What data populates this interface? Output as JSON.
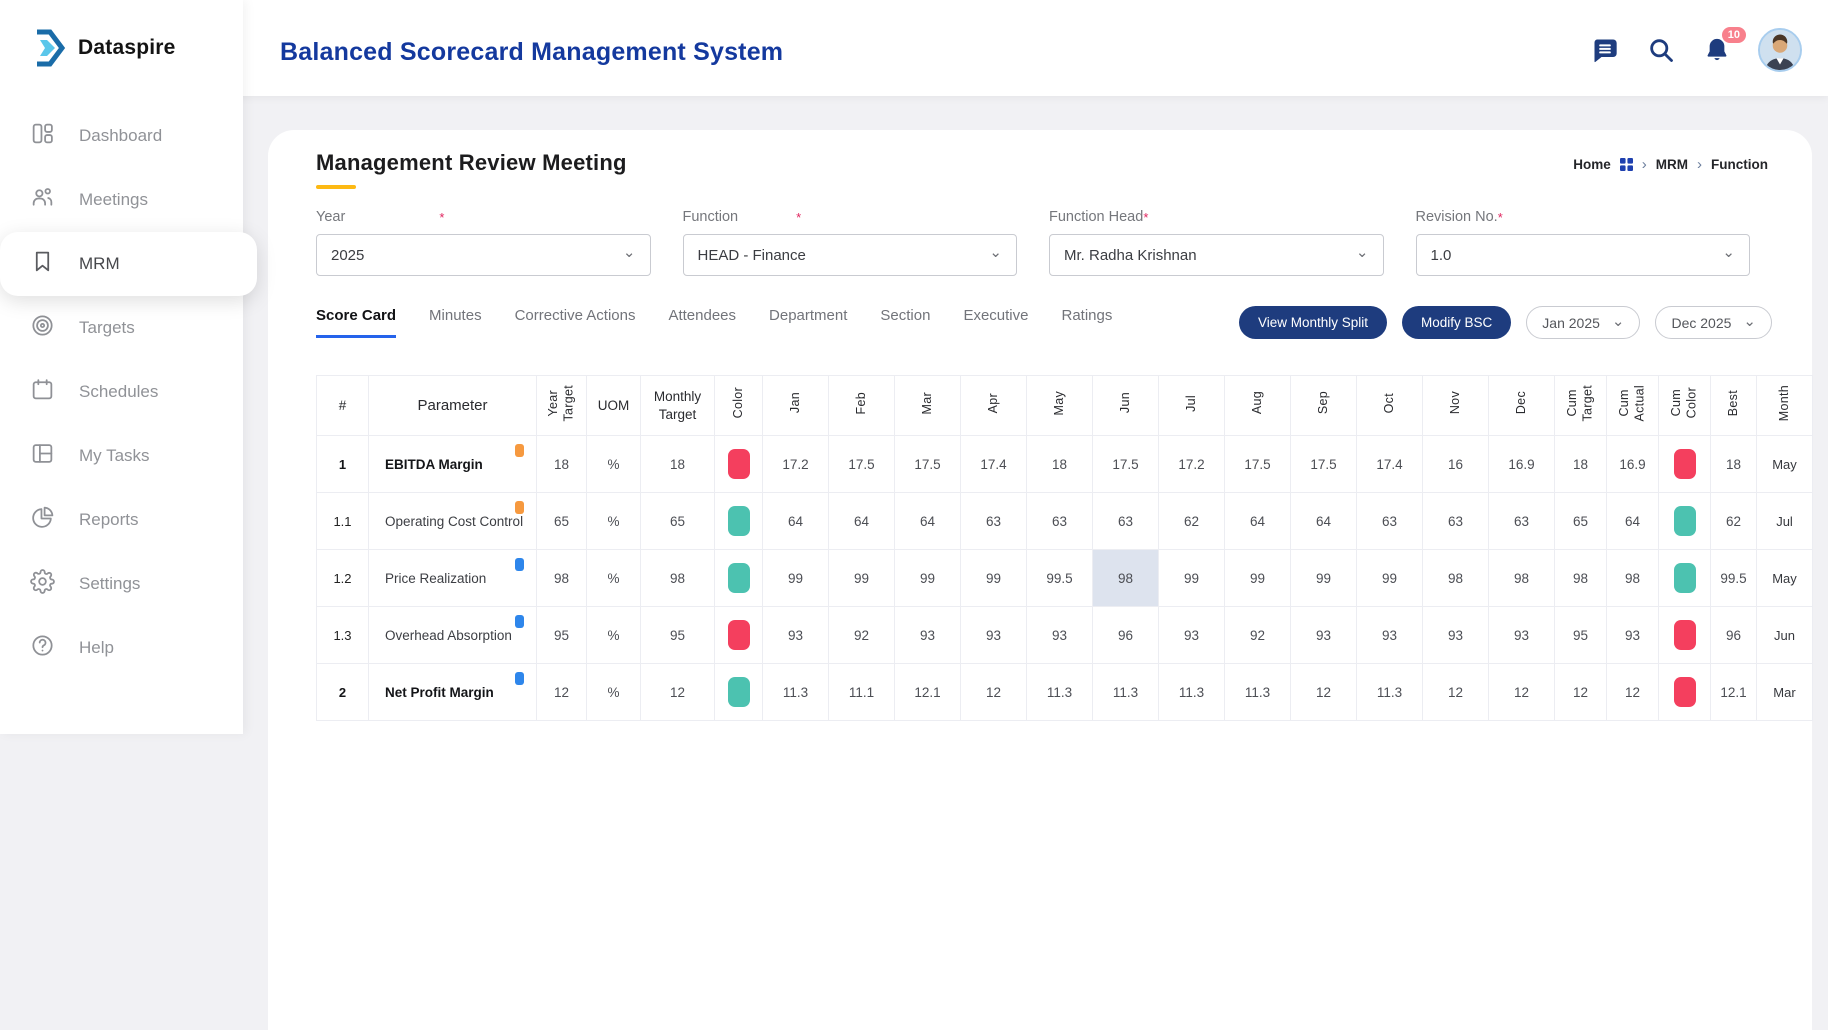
{
  "brand": {
    "name": "Dataspire",
    "logo_icon": "dataspire-chevron-logo"
  },
  "header": {
    "title": "Balanced Scorecard Management System",
    "notification_count": "10",
    "icons": [
      "chat-icon",
      "search-icon",
      "bell-icon",
      "avatar"
    ]
  },
  "sidebar": {
    "items": [
      {
        "id": "dashboard",
        "label": "Dashboard",
        "icon": "dashboard-icon",
        "active": false
      },
      {
        "id": "meetings",
        "label": "Meetings",
        "icon": "meetings-icon",
        "active": false
      },
      {
        "id": "mrm",
        "label": "MRM",
        "icon": "bookmark-icon",
        "active": true
      },
      {
        "id": "targets",
        "label": "Targets",
        "icon": "target-icon",
        "active": false
      },
      {
        "id": "schedules",
        "label": "Schedules",
        "icon": "calendar-icon",
        "active": false
      },
      {
        "id": "mytasks",
        "label": "My Tasks",
        "icon": "tasks-icon",
        "active": false
      },
      {
        "id": "reports",
        "label": "Reports",
        "icon": "pie-chart-icon",
        "active": false
      },
      {
        "id": "settings",
        "label": "Settings",
        "icon": "gear-icon",
        "active": false
      },
      {
        "id": "help",
        "label": "Help",
        "icon": "help-icon",
        "active": false
      }
    ]
  },
  "page": {
    "title": "Management Review Meeting",
    "breadcrumb": [
      "Home",
      "MRM",
      "Function"
    ],
    "filters": [
      {
        "id": "year",
        "label": "Year",
        "required": "*",
        "value": "2025"
      },
      {
        "id": "function",
        "label": "Function",
        "required": "*",
        "value": "HEAD - Finance"
      },
      {
        "id": "function-head",
        "label": "Function Head",
        "required": "*",
        "value": "Mr. Radha Krishnan"
      },
      {
        "id": "revision-no",
        "label": "Revision No.",
        "required": "*",
        "value": "1.0"
      }
    ],
    "tabs": [
      "Score Card",
      "Minutes",
      "Corrective Actions",
      "Attendees",
      "Department",
      "Section",
      "Executive",
      "Ratings"
    ],
    "active_tab": 0,
    "actions": {
      "view_monthly_split": "View Monthly Split",
      "modify_bsc": "Modify BSC",
      "range_from": "Jan 2025",
      "range_to": "Dec 2025"
    },
    "table": {
      "columns": [
        {
          "label": "#"
        },
        {
          "label": "Parameter",
          "big": true
        },
        {
          "label": "Year\nTarget",
          "rot": true
        },
        {
          "label": "UOM"
        },
        {
          "label": "Monthly Target"
        },
        {
          "label": "Color",
          "rot": true
        },
        {
          "label": "Jan",
          "rot": true
        },
        {
          "label": "Feb",
          "rot": true
        },
        {
          "label": "Mar",
          "rot": true
        },
        {
          "label": "Apr",
          "rot": true
        },
        {
          "label": "May",
          "rot": true
        },
        {
          "label": "Jun",
          "rot": true
        },
        {
          "label": "Jul",
          "rot": true
        },
        {
          "label": "Aug",
          "rot": true
        },
        {
          "label": "Sep",
          "rot": true
        },
        {
          "label": "Oct",
          "rot": true
        },
        {
          "label": "Nov",
          "rot": true
        },
        {
          "label": "Dec",
          "rot": true
        },
        {
          "label": "Cum\nTarget",
          "rot": true
        },
        {
          "label": "Cum\nActual",
          "rot": true
        },
        {
          "label": "Cum\nColor",
          "rot": true
        },
        {
          "label": "Best",
          "rot": true
        },
        {
          "label": "Month",
          "rot": true
        }
      ],
      "rows": [
        {
          "num": "1",
          "parameter": "EBITDA Margin",
          "bold": true,
          "badge": "orange",
          "year_target": 18,
          "uom": "%",
          "monthly_target": 18,
          "color": "red",
          "months": [
            17.2,
            17.5,
            17.5,
            17.4,
            18,
            17.5,
            17.2,
            17.5,
            17.5,
            17.4,
            16,
            16.9
          ],
          "cum_target": 18,
          "cum_actual": 16.9,
          "cum_color": "red",
          "best": 18,
          "best_month": "May"
        },
        {
          "num": "1.1",
          "parameter": "Operating Cost Control",
          "bold": false,
          "badge": "orange",
          "year_target": 65,
          "uom": "%",
          "monthly_target": 65,
          "color": "teal",
          "months": [
            64,
            64,
            64,
            63,
            63,
            63,
            62,
            64,
            64,
            63,
            63,
            63
          ],
          "cum_target": 65,
          "cum_actual": 64,
          "cum_color": "teal",
          "best": 62,
          "best_month": "Jul"
        },
        {
          "num": "1.2",
          "parameter": "Price Realization",
          "bold": false,
          "badge": "blue",
          "year_target": 98,
          "uom": "%",
          "monthly_target": 98,
          "color": "teal",
          "months": [
            99,
            99,
            99,
            99,
            99.5,
            98,
            99,
            99,
            99,
            99,
            98,
            98
          ],
          "highlight_month": 5,
          "cum_target": 98,
          "cum_actual": 98,
          "cum_color": "teal",
          "best": 99.5,
          "best_month": "May"
        },
        {
          "num": "1.3",
          "parameter": "Overhead Absorption",
          "bold": false,
          "badge": "blue",
          "year_target": 95,
          "uom": "%",
          "monthly_target": 95,
          "color": "red",
          "months": [
            93,
            92,
            93,
            93,
            93,
            96,
            93,
            92,
            93,
            93,
            93,
            93
          ],
          "cum_target": 95,
          "cum_actual": 93,
          "cum_color": "red",
          "best": 96,
          "best_month": "Jun"
        },
        {
          "num": "2",
          "parameter": "Net Profit Margin",
          "bold": true,
          "badge": "blue",
          "year_target": 12,
          "uom": "%",
          "monthly_target": 12,
          "color": "teal",
          "months": [
            11.3,
            11.1,
            12.1,
            12,
            11.3,
            11.3,
            11.3,
            11.3,
            12,
            11.3,
            12,
            12
          ],
          "cum_target": 12,
          "cum_actual": 12,
          "cum_color": "red",
          "best": 12.1,
          "best_month": "Mar"
        }
      ]
    }
  },
  "colors": {
    "red": "#f43f5e",
    "teal": "#4cc2b0",
    "orange": "#f6993f",
    "blue": "#2e86eb",
    "navy": "#1e3c7e",
    "title_blue": "#14399e",
    "tab_underline": "#2563eb",
    "title_dash": "#fdb913",
    "highlight_cell": "#dde3ee",
    "badge_pink": "#f8808c"
  }
}
